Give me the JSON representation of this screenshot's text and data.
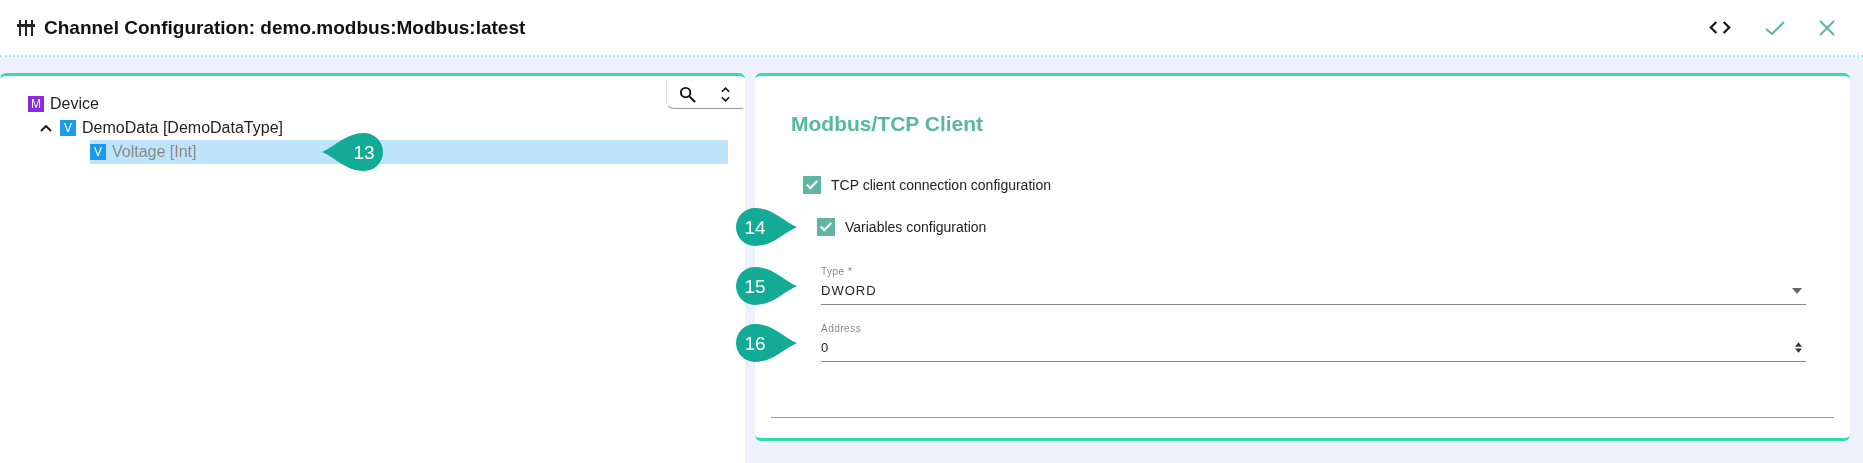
{
  "window": {
    "title": "Channel Configuration: demo.modbus:Modbus:latest"
  },
  "tree": [
    {
      "badge": "M",
      "color": "#8a2be2",
      "label": "Device",
      "expanded": false,
      "selected": false
    },
    {
      "badge": "V",
      "color": "#1e9be8",
      "label": "DemoData [DemoDataType]",
      "expanded": true,
      "selected": false,
      "children": [
        {
          "badge": "V",
          "color": "#1e9be8",
          "label": "Voltage [Int]",
          "selected": true,
          "callout": "13"
        }
      ]
    }
  ],
  "panel": {
    "title": "Modbus/TCP Client",
    "options": [
      {
        "label": "TCP client connection configuration",
        "checked": true
      },
      {
        "label": "Variables configuration",
        "checked": true,
        "callout": "14"
      }
    ],
    "fields": [
      {
        "kind": "select",
        "label": "Type *",
        "value": "DWORD",
        "callout": "15"
      },
      {
        "kind": "number",
        "label": "Address",
        "value": "0",
        "callout": "16"
      }
    ]
  }
}
